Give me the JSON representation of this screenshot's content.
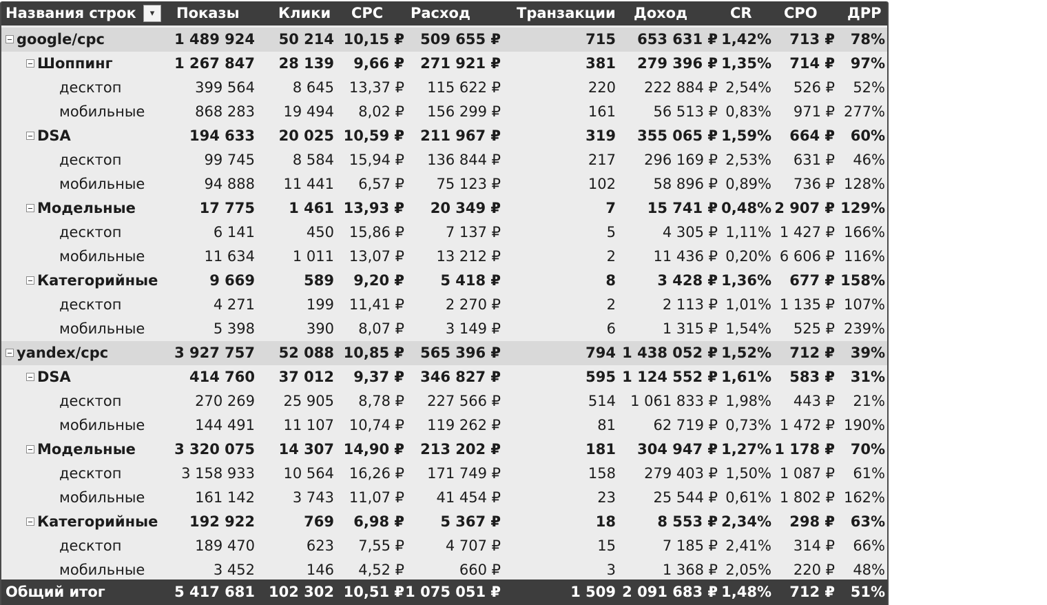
{
  "header": {
    "row_labels": "Названия строк",
    "filter_icon": "filter-dropdown-icon",
    "columns": [
      "Показы",
      "Клики",
      "CPC",
      "Расход",
      "Транзакции",
      "Доход",
      "CR",
      "CPO",
      "ДРР"
    ]
  },
  "rows": [
    {
      "type": "source",
      "label": "google/cpc",
      "values": [
        "1 489 924",
        "50 214",
        "10,15 ₽",
        "509 655 ₽",
        "715",
        "653 631 ₽",
        "1,42%",
        "713 ₽",
        "78%"
      ]
    },
    {
      "type": "group",
      "label": "Шоппинг",
      "values": [
        "1 267 847",
        "28 139",
        "9,66 ₽",
        "271 921 ₽",
        "381",
        "279 396 ₽",
        "1,35%",
        "714 ₽",
        "97%"
      ]
    },
    {
      "type": "leaf",
      "label": "десктоп",
      "values": [
        "399 564",
        "8 645",
        "13,37 ₽",
        "115 622 ₽",
        "220",
        "222 884 ₽",
        "2,54%",
        "526 ₽",
        "52%"
      ]
    },
    {
      "type": "leaf",
      "label": "мобильные",
      "values": [
        "868 283",
        "19 494",
        "8,02 ₽",
        "156 299 ₽",
        "161",
        "56 513 ₽",
        "0,83%",
        "971 ₽",
        "277%"
      ]
    },
    {
      "type": "group",
      "label": "DSA",
      "values": [
        "194 633",
        "20 025",
        "10,59 ₽",
        "211 967 ₽",
        "319",
        "355 065 ₽",
        "1,59%",
        "664 ₽",
        "60%"
      ]
    },
    {
      "type": "leaf",
      "label": "десктоп",
      "values": [
        "99 745",
        "8 584",
        "15,94 ₽",
        "136 844 ₽",
        "217",
        "296 169 ₽",
        "2,53%",
        "631 ₽",
        "46%"
      ]
    },
    {
      "type": "leaf",
      "label": "мобильные",
      "values": [
        "94 888",
        "11 441",
        "6,57 ₽",
        "75 123 ₽",
        "102",
        "58 896 ₽",
        "0,89%",
        "736 ₽",
        "128%"
      ]
    },
    {
      "type": "group",
      "label": "Модельные",
      "values": [
        "17 775",
        "1 461",
        "13,93 ₽",
        "20 349 ₽",
        "7",
        "15 741 ₽",
        "0,48%",
        "2 907 ₽",
        "129%"
      ]
    },
    {
      "type": "leaf",
      "label": "десктоп",
      "values": [
        "6 141",
        "450",
        "15,86 ₽",
        "7 137 ₽",
        "5",
        "4 305 ₽",
        "1,11%",
        "1 427 ₽",
        "166%"
      ]
    },
    {
      "type": "leaf",
      "label": "мобильные",
      "values": [
        "11 634",
        "1 011",
        "13,07 ₽",
        "13 212 ₽",
        "2",
        "11 436 ₽",
        "0,20%",
        "6 606 ₽",
        "116%"
      ]
    },
    {
      "type": "group",
      "label": "Категорийные",
      "values": [
        "9 669",
        "589",
        "9,20 ₽",
        "5 418 ₽",
        "8",
        "3 428 ₽",
        "1,36%",
        "677 ₽",
        "158%"
      ]
    },
    {
      "type": "leaf",
      "label": "десктоп",
      "values": [
        "4 271",
        "199",
        "11,41 ₽",
        "2 270 ₽",
        "2",
        "2 113 ₽",
        "1,01%",
        "1 135 ₽",
        "107%"
      ]
    },
    {
      "type": "leaf",
      "label": "мобильные",
      "values": [
        "5 398",
        "390",
        "8,07 ₽",
        "3 149 ₽",
        "6",
        "1 315 ₽",
        "1,54%",
        "525 ₽",
        "239%"
      ]
    },
    {
      "type": "source",
      "label": "yandex/cpc",
      "values": [
        "3 927 757",
        "52 088",
        "10,85 ₽",
        "565 396 ₽",
        "794",
        "1 438 052 ₽",
        "1,52%",
        "712 ₽",
        "39%"
      ]
    },
    {
      "type": "group",
      "label": "DSA",
      "values": [
        "414 760",
        "37 012",
        "9,37 ₽",
        "346 827 ₽",
        "595",
        "1 124 552 ₽",
        "1,61%",
        "583 ₽",
        "31%"
      ]
    },
    {
      "type": "leaf",
      "label": "десктоп",
      "values": [
        "270 269",
        "25 905",
        "8,78 ₽",
        "227 566 ₽",
        "514",
        "1 061 833 ₽",
        "1,98%",
        "443 ₽",
        "21%"
      ]
    },
    {
      "type": "leaf",
      "label": "мобильные",
      "values": [
        "144 491",
        "11 107",
        "10,74 ₽",
        "119 262 ₽",
        "81",
        "62 719 ₽",
        "0,73%",
        "1 472 ₽",
        "190%"
      ]
    },
    {
      "type": "group",
      "label": "Модельные",
      "values": [
        "3 320 075",
        "14 307",
        "14,90 ₽",
        "213 202 ₽",
        "181",
        "304 947 ₽",
        "1,27%",
        "1 178 ₽",
        "70%"
      ]
    },
    {
      "type": "leaf",
      "label": "десктоп",
      "values": [
        "3 158 933",
        "10 564",
        "16,26 ₽",
        "171 749 ₽",
        "158",
        "279 403 ₽",
        "1,50%",
        "1 087 ₽",
        "61%"
      ]
    },
    {
      "type": "leaf",
      "label": "мобильные",
      "values": [
        "161 142",
        "3 743",
        "11,07 ₽",
        "41 454 ₽",
        "23",
        "25 544 ₽",
        "0,61%",
        "1 802 ₽",
        "162%"
      ]
    },
    {
      "type": "group",
      "label": "Категорийные",
      "values": [
        "192 922",
        "769",
        "6,98 ₽",
        "5 367 ₽",
        "18",
        "8 553 ₽",
        "2,34%",
        "298 ₽",
        "63%"
      ]
    },
    {
      "type": "leaf",
      "label": "десктоп",
      "values": [
        "189 470",
        "623",
        "7,55 ₽",
        "4 707 ₽",
        "15",
        "7 185 ₽",
        "2,41%",
        "314 ₽",
        "66%"
      ]
    },
    {
      "type": "leaf",
      "label": "мобильные",
      "values": [
        "3 452",
        "146",
        "4,52 ₽",
        "660 ₽",
        "3",
        "1 368 ₽",
        "2,05%",
        "220 ₽",
        "48%"
      ]
    }
  ],
  "total": {
    "label": "Общий итог",
    "values": [
      "5 417 681",
      "102 302",
      "10,51 ₽",
      "1 075 051 ₽",
      "1 509",
      "2 091 683 ₽",
      "1,48%",
      "712 ₽",
      "51%"
    ]
  },
  "colors": {
    "header_bg": "#3d3d3d",
    "source_row_bg": "#d9d9d9",
    "body_bg": "#ececec"
  }
}
